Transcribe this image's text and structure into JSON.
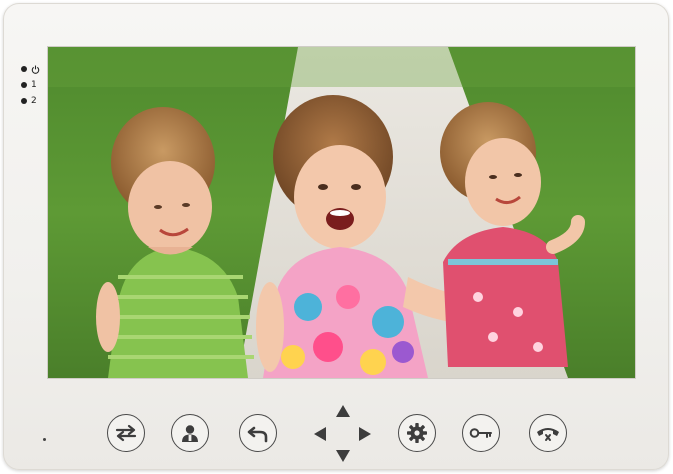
{
  "indicators": {
    "power_icon": "power-icon",
    "line1_label": "1",
    "line2_label": "2"
  },
  "screen": {
    "content": "camera-feed-photo"
  },
  "buttons": [
    {
      "id": "transfer",
      "icon": "transfer-arrows-icon"
    },
    {
      "id": "user",
      "icon": "person-icon"
    },
    {
      "id": "back",
      "icon": "back-arrow-icon"
    },
    {
      "id": "navigate",
      "icon": "dpad-icon"
    },
    {
      "id": "settings",
      "icon": "gear-icon"
    },
    {
      "id": "unlock",
      "icon": "key-icon"
    },
    {
      "id": "handset",
      "icon": "phone-handset-icon"
    }
  ],
  "colors": {
    "bezel": "#f1f0ed",
    "button_border": "#4a4a4a",
    "icon": "#3d3d3d",
    "led": "#222222"
  }
}
